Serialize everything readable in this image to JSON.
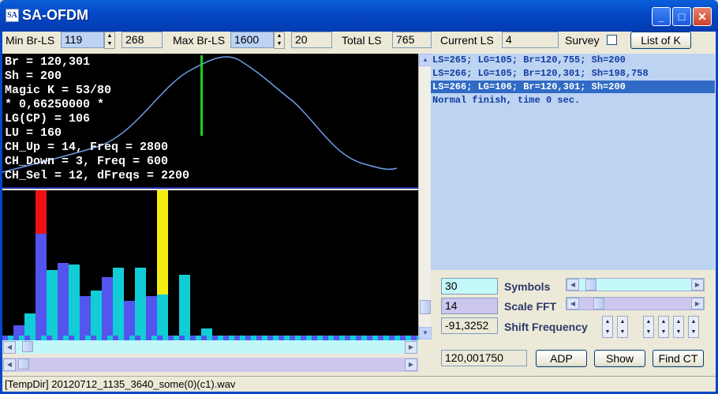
{
  "window": {
    "title": "SA-OFDM",
    "icon_text": "SA",
    "min_label": "_",
    "max_label": "□",
    "close_label": "✕"
  },
  "toolbar": {
    "min_br_ls_label": "Min Br-LS",
    "min_br_ls_value": "119",
    "min_br_ls_second": "268",
    "max_br_ls_label": "Max Br-LS",
    "max_br_ls_value": "1600",
    "max_br_ls_second": "20",
    "total_ls_label": "Total LS",
    "total_ls_value": "765",
    "current_ls_label": "Current LS",
    "current_ls_value": "4",
    "survey_label": "Survey",
    "survey_checked": false,
    "list_of_k_label": "List of K"
  },
  "plot": {
    "lines": [
      "Br = 120,301",
      "Sh = 200",
      "Magic K = 53/80",
      "* 0,66250000 *",
      "LG(CP) = 106",
      "LU = 160",
      "CH_Up = 14, Freq = 2800",
      "CH_Down = 3, Freq = 600",
      "CH_Sel = 12, dFreqs = 2200"
    ]
  },
  "spectrum": {
    "bars": [
      {
        "v": 0.07,
        "c": "#5454ee"
      },
      {
        "v": 0.15,
        "c": "#11cdd6"
      },
      {
        "v": 1.0,
        "c": "#5454ee",
        "top": 0.3,
        "topc": "#ee1111"
      },
      {
        "v": 0.45,
        "c": "#11cdd6"
      },
      {
        "v": 0.5,
        "c": "#5454ee"
      },
      {
        "v": 0.49,
        "c": "#11cdd6"
      },
      {
        "v": 0.27,
        "c": "#5454ee"
      },
      {
        "v": 0.31,
        "c": "#11cdd6"
      },
      {
        "v": 0.4,
        "c": "#5454ee"
      },
      {
        "v": 0.47,
        "c": "#11cdd6"
      },
      {
        "v": 0.24,
        "c": "#5454ee"
      },
      {
        "v": 0.47,
        "c": "#11cdd6"
      },
      {
        "v": 0.27,
        "c": "#5454ee"
      },
      {
        "v": 1.0,
        "c": "#11cdd6",
        "top": 0.72,
        "topc": "#f2ee12"
      },
      {
        "v": 0.0,
        "c": "#5454ee"
      },
      {
        "v": 0.42,
        "c": "#11cdd6"
      },
      {
        "v": 0.0,
        "c": "#5454ee"
      },
      {
        "v": 0.05,
        "c": "#11cdd6"
      }
    ]
  },
  "log": {
    "lines": [
      "LS=265; LG=105; Br=120,755; Sh=200",
      "LS=266; LG=105; Br=120,301; Sh=198,758",
      "LS=266; LG=106; Br=120,301; Sh=200",
      "Normal finish, time 0 sec."
    ],
    "selected": 2
  },
  "controls": {
    "symbols_value": "30",
    "symbols_label": "Symbols",
    "scale_fft_value": "14",
    "scale_fft_label": "Scale FFT",
    "shift_value": "-91,3252",
    "shift_label": "Shift Frequency",
    "br_value": "120,001750",
    "adp_label": "ADP",
    "show_label": "Show",
    "find_ct_label": "Find CT"
  },
  "status": {
    "text": "[TempDir] 20120712_1135_3640_some(0)(c1).wav"
  },
  "colors": {
    "accent": "#0447c7",
    "curve": "#6f9be8",
    "marker": "#22cc22"
  }
}
